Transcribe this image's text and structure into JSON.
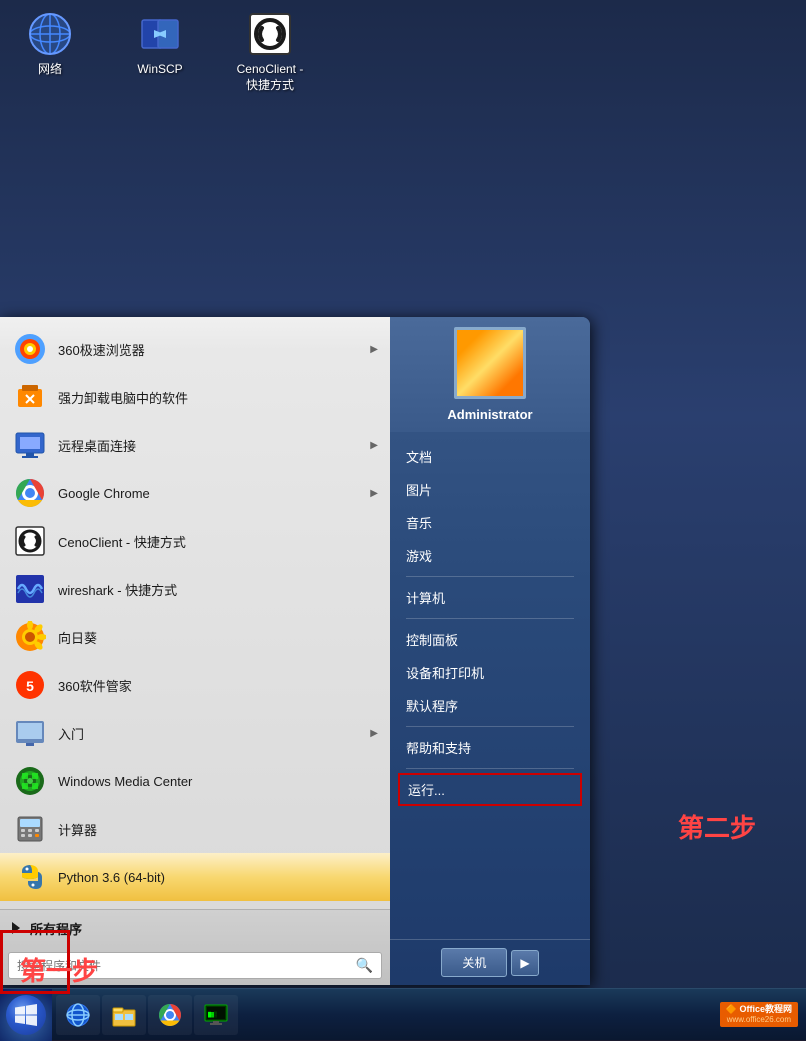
{
  "desktop": {
    "icons": [
      {
        "id": "network",
        "label": "网络",
        "type": "network"
      },
      {
        "id": "winscp",
        "label": "WinSCP",
        "type": "winscp"
      },
      {
        "id": "cenoclient",
        "label": "CenoClient -\n快捷方式",
        "type": "cenoclient"
      }
    ]
  },
  "startmenu": {
    "left": {
      "items": [
        {
          "id": "360browser",
          "label": "360极速浏览器",
          "hasArrow": true,
          "iconType": "360"
        },
        {
          "id": "uninstall",
          "label": "强力卸载电脑中的软件",
          "hasArrow": false,
          "iconType": "uninstall"
        },
        {
          "id": "remote",
          "label": "远程桌面连接",
          "hasArrow": true,
          "iconType": "remote"
        },
        {
          "id": "chrome",
          "label": "Google Chrome",
          "hasArrow": true,
          "iconType": "chrome"
        },
        {
          "id": "cenoclient",
          "label": "CenoClient - 快捷方式",
          "hasArrow": false,
          "iconType": "cenoclient"
        },
        {
          "id": "wireshark",
          "label": "wireshark - 快捷方式",
          "hasArrow": false,
          "iconType": "wireshark"
        },
        {
          "id": "sunflower",
          "label": "向日葵",
          "hasArrow": false,
          "iconType": "sunflower"
        },
        {
          "id": "360manager",
          "label": "360软件管家",
          "hasArrow": false,
          "iconType": "360manager"
        },
        {
          "id": "intro",
          "label": "入门",
          "hasArrow": true,
          "iconType": "intro"
        },
        {
          "id": "mediaCenter",
          "label": "Windows Media Center",
          "hasArrow": false,
          "iconType": "mediacenter"
        },
        {
          "id": "calc",
          "label": "计算器",
          "hasArrow": false,
          "iconType": "calc"
        },
        {
          "id": "python",
          "label": "Python 3.6 (64-bit)",
          "hasArrow": false,
          "iconType": "python",
          "active": true
        }
      ],
      "allPrograms": "所有程序",
      "searchPlaceholder": "搜索程序和文件"
    },
    "right": {
      "username": "Administrator",
      "items": [
        {
          "id": "docs",
          "label": "文档"
        },
        {
          "id": "pictures",
          "label": "图片"
        },
        {
          "id": "music",
          "label": "音乐"
        },
        {
          "id": "games",
          "label": "游戏"
        },
        {
          "id": "computer",
          "label": "计算机"
        },
        {
          "id": "controlpanel",
          "label": "控制面板"
        },
        {
          "id": "devices",
          "label": "设备和打印机"
        },
        {
          "id": "defaults",
          "label": "默认程序"
        },
        {
          "id": "help",
          "label": "帮助和支持"
        },
        {
          "id": "run",
          "label": "运行..."
        }
      ],
      "shutdown": "关机"
    }
  },
  "taskbar": {
    "apps": [
      {
        "id": "start",
        "type": "start"
      },
      {
        "id": "ie",
        "type": "ie"
      },
      {
        "id": "explorer",
        "type": "explorer"
      },
      {
        "id": "chrome-task",
        "type": "chrome"
      },
      {
        "id": "monitor",
        "type": "monitor"
      }
    ],
    "tray": {
      "officeBadge": "Office教程网",
      "officeSite": "www.office26.com"
    }
  },
  "annotations": {
    "step1": "第一步",
    "step2": "第二步"
  }
}
